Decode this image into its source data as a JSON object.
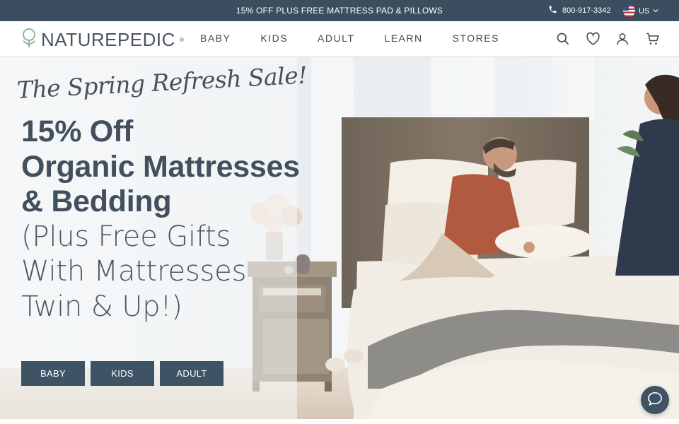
{
  "announcement": {
    "promo_text": "15% OFF PLUS FREE MATTRESS PAD & PILLOWS",
    "phone": "800-917-3342",
    "locale": "US",
    "phone_icon": "phone-icon",
    "flag_icon": "us-flag-icon"
  },
  "header": {
    "logo_text": "NATUREPEDIC",
    "logo_mark": "®",
    "nav": [
      "BABY",
      "KIDS",
      "ADULT",
      "LEARN",
      "STORES"
    ],
    "icons": [
      "search-icon",
      "heart-icon",
      "account-icon",
      "cart-icon"
    ]
  },
  "hero": {
    "script_heading": "The Spring Refresh Sale!",
    "headline_bold": [
      "15% Off",
      "Organic Mattresses",
      "& Bedding"
    ],
    "headline_light": [
      "(Plus Free Gifts",
      "With Mattresses",
      "Twin & Up!)"
    ],
    "buttons": [
      "BABY",
      "KIDS",
      "ADULT"
    ]
  },
  "chat": {
    "icon": "chat-icon"
  },
  "colors": {
    "announcement_bg": "#3b4d5e",
    "button_bg": "#3e5363",
    "heading_text": "#42505d"
  }
}
